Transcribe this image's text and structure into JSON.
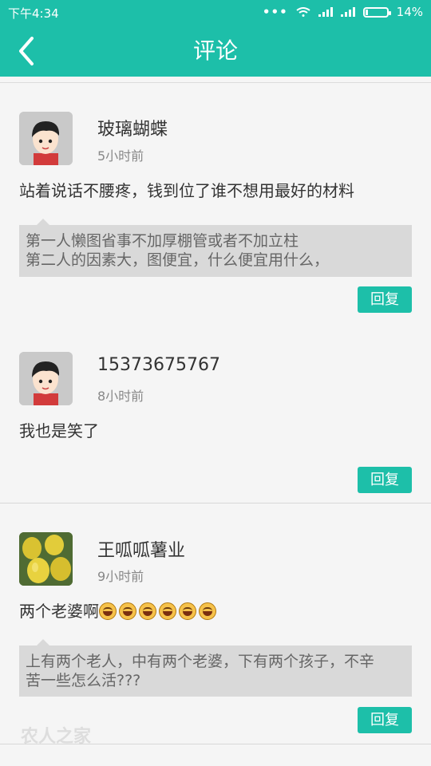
{
  "statusbar": {
    "time": "下午4:34",
    "battery": "14%"
  },
  "header": {
    "title": "评论",
    "back_icon": "back-arrow-icon",
    "bg_color": "#1dbfa9"
  },
  "comments": [
    {
      "author": "玻璃蝴蝶",
      "time": "5小时前",
      "text": "站着说话不腰疼，钱到位了谁不想用最好的材料",
      "quote_lines": [
        "第一人懒图省事不加厚棚管或者不加立柱",
        "第二人的因素大，图便宜，什么便宜用什么，"
      ],
      "reply_label": "回复"
    },
    {
      "author": "15373675767",
      "time": "8小时前",
      "text": "我也是笑了",
      "reply_label": "回复"
    },
    {
      "author": "王呱呱薯业",
      "time": "9小时前",
      "text": "两个老婆啊",
      "emoji_count": 6,
      "quote_lines": [
        "上有两个老人，中有两个老婆，下有两个孩子，不辛",
        "苦一些怎么活???"
      ],
      "reply_label": "回复"
    }
  ],
  "watermark": "农人之家"
}
